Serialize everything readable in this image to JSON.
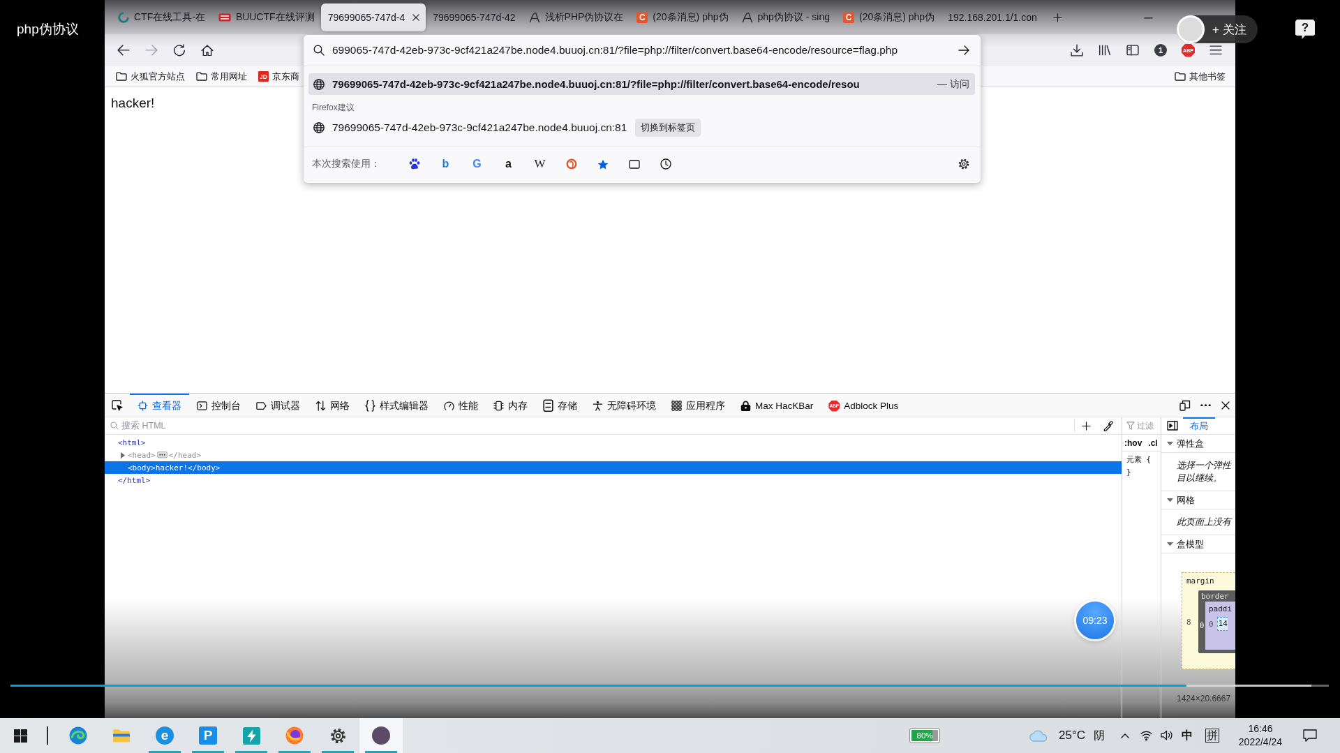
{
  "player": {
    "title": "php伪协议",
    "follow_button": {
      "label": "+ 关注"
    },
    "help_button": {
      "label": "?"
    },
    "timestamp": "09:23",
    "progress": {
      "level": 0.892
    }
  },
  "browser": {
    "tabs": [
      {
        "title": "CTF在线工具-在",
        "kind": "ring",
        "selected": false
      },
      {
        "title": "BUUCTF在线评测",
        "kind": "mark",
        "selected": false
      },
      {
        "title": "79699065-747d-4",
        "kind": "none",
        "selected": true
      },
      {
        "title": "79699065-747d-42",
        "kind": "none",
        "selected": false
      },
      {
        "title": "浅析PHP伪协议在",
        "kind": "curve",
        "selected": false
      },
      {
        "title": "(20条消息) php伪",
        "kind": "letter",
        "glyph": "C",
        "selected": false
      },
      {
        "title": "php伪协议 - sing",
        "kind": "curve",
        "selected": false
      },
      {
        "title": "(20条消息) php伪",
        "kind": "letter",
        "glyph": "C",
        "selected": false
      },
      {
        "title": "192.168.201.1/1.con",
        "kind": "none",
        "selected": false
      }
    ],
    "nav_buttons": [
      {
        "kind": "back",
        "disabled": false
      },
      {
        "kind": "forward",
        "disabled": true
      },
      {
        "kind": "reload",
        "disabled": false
      },
      {
        "kind": "home",
        "disabled": false
      }
    ],
    "toolbar": [
      {
        "kind": "download"
      },
      {
        "kind": "library"
      },
      {
        "kind": "sidebar"
      },
      {
        "kind": "count",
        "text": "1"
      },
      {
        "kind": "blocker",
        "text": "ABP"
      },
      {
        "kind": "menu"
      }
    ],
    "bookmarks": [
      {
        "kind": "folder",
        "label": "火狐官方站点"
      },
      {
        "kind": "folder",
        "label": "常用网址"
      },
      {
        "kind": "badge",
        "badge": "JD",
        "label": "京东商"
      }
    ],
    "other_bookmarks": {
      "label": "其他书签"
    },
    "page": {
      "text": "hacker!"
    },
    "url_panel": {
      "address": {
        "value": "699065-747d-42eb-973c-9cf421a247be.node4.buuoj.cn:81/?file=php://filter/convert.base64-encode/resource=flag.php"
      },
      "top_result": {
        "url": "79699065-747d-42eb-973c-9cf421a247be.node4.buuoj.cn:81/?file=php://filter/convert.base64-encode/resou",
        "action": "— 访问",
        "selected": true
      },
      "suggest_heading": "Firefox建议",
      "suggestions": [
        {
          "url": "79699065-747d-42eb-973c-9cf421a247be.node4.buuoj.cn:81",
          "action": "切换到标签页",
          "selected": false
        }
      ],
      "engines_label": "本次搜索使用：",
      "engines": [
        {
          "kind": "paw"
        },
        {
          "kind": "letter",
          "glyph": "b",
          "color": "#1f7ed8"
        },
        {
          "kind": "letter",
          "glyph": "G",
          "color": "#4285f4"
        },
        {
          "kind": "letter",
          "glyph": "a",
          "color": "#111111"
        },
        {
          "kind": "serif-letter",
          "glyph": "W",
          "color": "#222222"
        },
        {
          "kind": "duck"
        },
        {
          "kind": "star"
        },
        {
          "kind": "tabs"
        },
        {
          "kind": "history"
        }
      ]
    }
  },
  "devtools": {
    "tabs": [
      {
        "kind": "inspector",
        "label": "查看器",
        "selected": true
      },
      {
        "kind": "console",
        "label": "控制台",
        "selected": false
      },
      {
        "kind": "debugger",
        "label": "调试器",
        "selected": false
      },
      {
        "kind": "network",
        "label": "网络",
        "selected": false
      },
      {
        "kind": "style",
        "label": "样式编辑器",
        "selected": false
      },
      {
        "kind": "performance",
        "label": "性能",
        "selected": false
      },
      {
        "kind": "memory",
        "label": "内存",
        "selected": false
      },
      {
        "kind": "storage",
        "label": "存储",
        "selected": false
      },
      {
        "kind": "accessibility",
        "label": "无障碍环境",
        "selected": false
      },
      {
        "kind": "application",
        "label": "应用程序",
        "selected": false
      },
      {
        "kind": "hackbar",
        "label": "Max HacKBar",
        "selected": false
      },
      {
        "kind": "blocker",
        "label": "Adblock Plus",
        "badge": "ABP",
        "selected": false
      }
    ],
    "search": {
      "placeholder": "搜索 HTML"
    },
    "markup": [
      {
        "open": "<html>",
        "close": "</html>",
        "expanded": true,
        "hidden": false,
        "selected": false,
        "children": [
          {
            "open": "<head>",
            "close": "</head>",
            "expanded": false,
            "hidden": true,
            "selected": false
          },
          {
            "open": "<body>",
            "text": "hacker!",
            "close": "</body>",
            "expanded": true,
            "hidden": false,
            "selected": true
          }
        ]
      }
    ],
    "rules": {
      "filter": {
        "placeholder": "过滤"
      },
      "toggles": [
        ":hov",
        ".cl"
      ],
      "selector": "元素 {",
      "close": "}"
    },
    "layout": {
      "tabs": [
        {
          "label": "布局",
          "selected": true
        }
      ],
      "sections": [
        {
          "title": "弹性盒",
          "expanded": true,
          "note": "选择一个弹性目以继续。"
        },
        {
          "title": "网格",
          "expanded": true,
          "note": "此页面上没有"
        },
        {
          "title": "盒模型",
          "expanded": true,
          "box_model": {
            "layers": [
              {
                "kind": "margin",
                "label": "margin",
                "reading": "8"
              },
              {
                "kind": "border",
                "label": "border",
                "reading": "0"
              },
              {
                "kind": "padding",
                "label": "paddi",
                "reading": "0"
              }
            ],
            "content": "14"
          }
        }
      ],
      "size": "1424×20.6667"
    }
  },
  "taskbar": {
    "apps": [
      {
        "kind": "swirl",
        "running": false,
        "selected": false
      },
      {
        "kind": "folder",
        "running": false,
        "selected": false
      },
      {
        "kind": "letter-circle",
        "glyph": "e",
        "running": true,
        "selected": false
      },
      {
        "kind": "letter-square",
        "glyph": "P",
        "running": true,
        "selected": false
      },
      {
        "kind": "bolt",
        "running": true,
        "selected": false
      },
      {
        "kind": "browser",
        "running": true,
        "selected": false
      },
      {
        "kind": "gear",
        "running": true,
        "selected": false
      },
      {
        "kind": "avatar",
        "running": true,
        "selected": true
      }
    ],
    "battery": "80%",
    "weather": {
      "temperature": "25°C",
      "condition": "阴"
    },
    "input_mode": [
      "中",
      "拼"
    ],
    "time": "16:46",
    "date": "2022/4/24"
  }
}
